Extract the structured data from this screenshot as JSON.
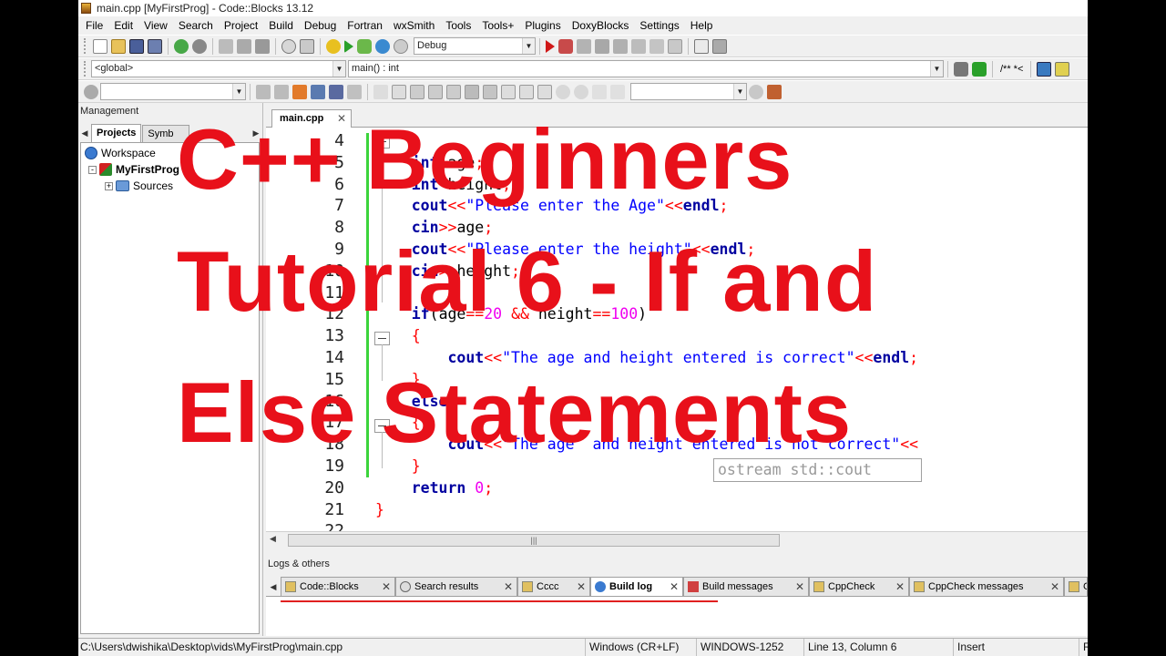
{
  "window": {
    "title": "main.cpp [MyFirstProg] - Code::Blocks 13.12"
  },
  "menu": [
    "File",
    "Edit",
    "View",
    "Search",
    "Project",
    "Build",
    "Debug",
    "Fortran",
    "wxSmith",
    "Tools",
    "Tools+",
    "Plugins",
    "DoxyBlocks",
    "Settings",
    "Help"
  ],
  "toolbar": {
    "build_target": "Debug",
    "scope": "<global>",
    "function": "main() : int",
    "comment_btn": "/** *<"
  },
  "management": {
    "title": "Management",
    "tabs": [
      "Projects",
      "Symb"
    ],
    "tree": {
      "workspace": "Workspace",
      "project": "MyFirstProg",
      "sources": "Sources"
    }
  },
  "editor": {
    "tab": "main.cpp",
    "lines": [
      {
        "n": "4",
        "t": ""
      },
      {
        "n": "5",
        "t": "    int age;"
      },
      {
        "n": "6",
        "t": "    int height;"
      },
      {
        "n": "7",
        "t": "    cout<<\"Please enter the Age\"<<endl;"
      },
      {
        "n": "8",
        "t": "    cin>>age;"
      },
      {
        "n": "9",
        "t": "    cout<<\"Please enter the height\"<<endl;"
      },
      {
        "n": "10",
        "t": "    cin>>height;"
      },
      {
        "n": "11",
        "t": ""
      },
      {
        "n": "12",
        "t": "    if(age==20 && height==100)"
      },
      {
        "n": "13",
        "t": "    {"
      },
      {
        "n": "14",
        "t": "        cout<<\"The age and height entered is correct\"<<endl;"
      },
      {
        "n": "15",
        "t": "    }"
      },
      {
        "n": "16",
        "t": "    else"
      },
      {
        "n": "17",
        "t": "    {"
      },
      {
        "n": "18",
        "t": "        cout<<\"The age  and height entered is not correct\"<<"
      },
      {
        "n": "19",
        "t": "    }"
      },
      {
        "n": "20",
        "t": "    return 0;"
      },
      {
        "n": "21",
        "t": "}"
      },
      {
        "n": "22",
        "t": ""
      }
    ],
    "calltip": "ostream std::cout"
  },
  "logs": {
    "title": "Logs & others",
    "tabs": [
      {
        "label": "Code::Blocks",
        "icon": "note-icon"
      },
      {
        "label": "Search results",
        "icon": "search-icon"
      },
      {
        "label": "Cccc",
        "icon": "note-icon"
      },
      {
        "label": "Build log",
        "icon": "gear-icon",
        "active": true
      },
      {
        "label": "Build messages",
        "icon": "build-icon"
      },
      {
        "label": "CppCheck",
        "icon": "note-icon"
      },
      {
        "label": "CppCheck messages",
        "icon": "note-icon"
      },
      {
        "label": "C",
        "icon": "note-icon"
      }
    ]
  },
  "status": {
    "path": "C:\\Users\\dwishika\\Desktop\\vids\\MyFirstProg\\main.cpp",
    "eol": "Windows (CR+LF)",
    "encoding": "WINDOWS-1252",
    "position": "Line 13, Column 6",
    "mode": "Insert",
    "extra": "R"
  },
  "overlay": {
    "line1": "C++ Beginners",
    "line2": "Tutorial 6 - If and",
    "line3": "Else Statements"
  },
  "colors": {
    "overlay_red": "#e8101a",
    "keyword": "#0000a0",
    "string": "#0000ff",
    "number": "#f000f0",
    "operator": "#ff0000",
    "change_bar": "#3bd43b"
  }
}
